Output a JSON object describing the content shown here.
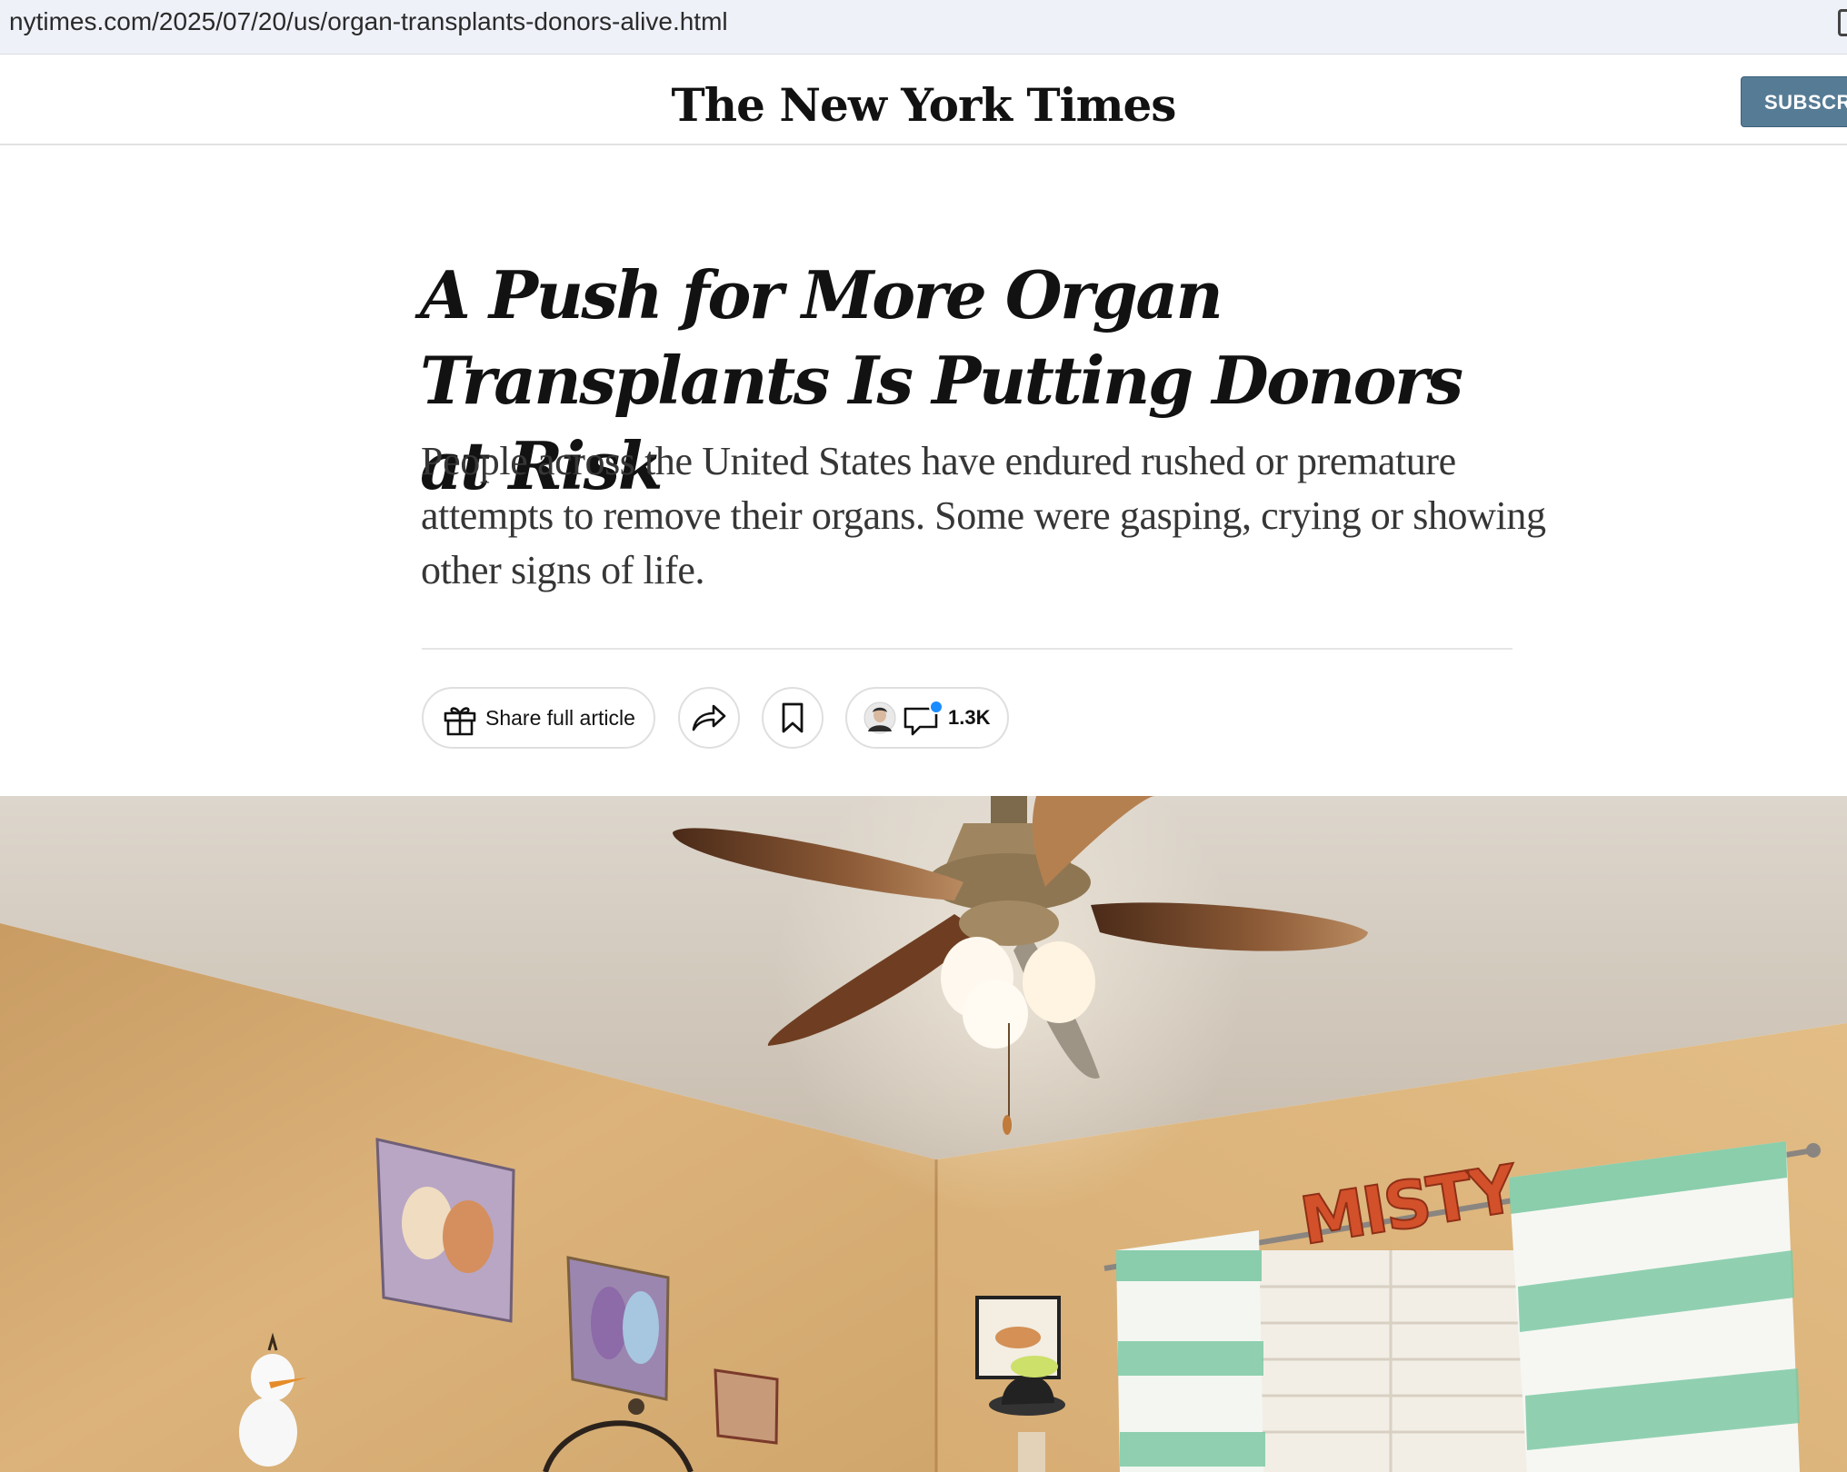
{
  "browser": {
    "url": "nytimes.com/2025/07/20/us/organ-transplants-donors-alive.html"
  },
  "masthead": {
    "logo_text": "The New York Times",
    "subscribe_label": "SUBSCR"
  },
  "article": {
    "headline": "A Push for More Organ Transplants Is Putting Donors at Risk",
    "summary": "People across the United States have endured rushed or premature attempts to remove their organs. Some were gasping, crying or showing other signs of life."
  },
  "toolbar": {
    "share_full_label": "Share full article",
    "comment_count": "1.3K",
    "icons": [
      "gift-icon",
      "share-arrow-icon",
      "bookmark-icon",
      "comment-bubble-icon"
    ]
  },
  "lead_image": {
    "wall_sign_text": "MISTY"
  },
  "colors": {
    "subscribe_bg": "#567b95",
    "url_bar_bg": "#eef1f8",
    "notification_dot": "#1a8cff",
    "headline": "#121212"
  }
}
